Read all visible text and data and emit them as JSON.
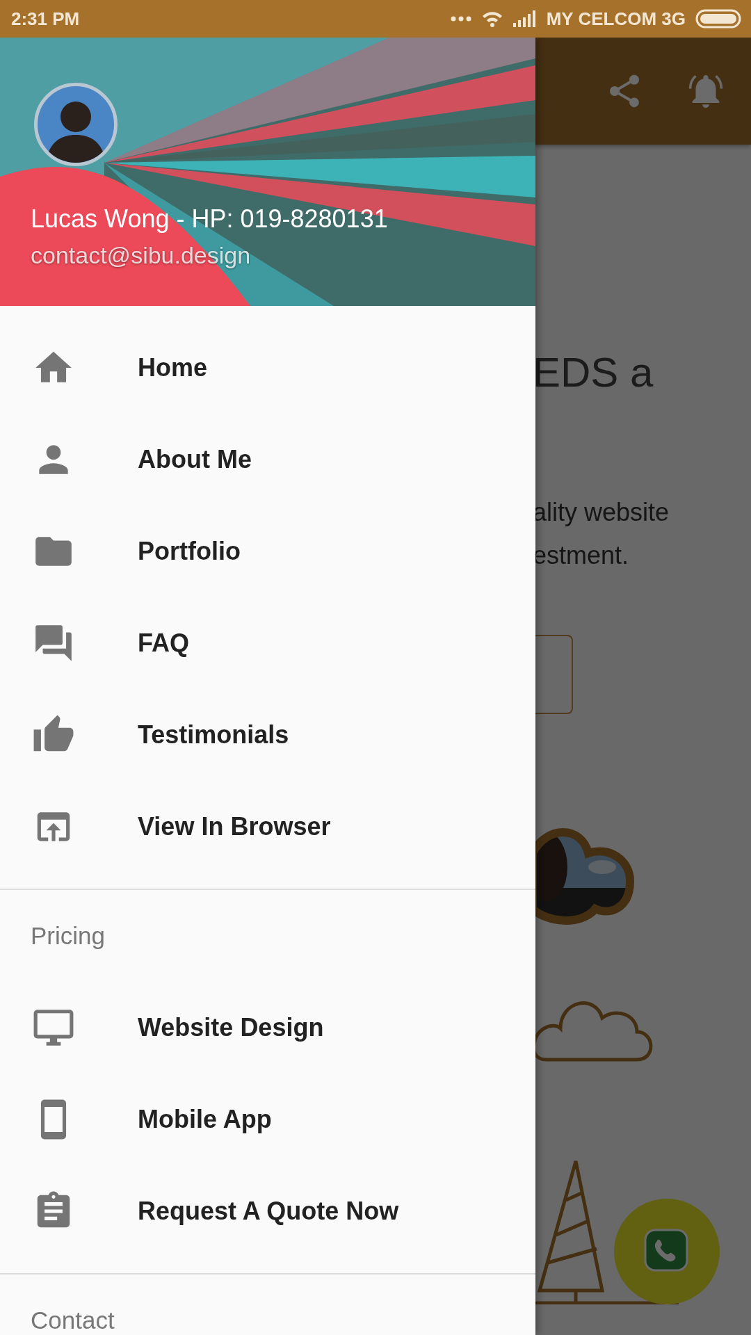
{
  "status_bar": {
    "time": "2:31 PM",
    "carrier": "MY CELCOM 3G"
  },
  "page_behind": {
    "headline": "EDS a",
    "body_lines": [
      "ality website",
      "estment."
    ]
  },
  "drawer": {
    "header": {
      "name": "Lucas Wong - HP: 019-8280131",
      "email": "contact@sibu.design"
    },
    "sections": [
      {
        "items": [
          {
            "label": "Home"
          },
          {
            "label": "About Me"
          },
          {
            "label": "Portfolio"
          },
          {
            "label": "FAQ"
          },
          {
            "label": "Testimonials"
          },
          {
            "label": "View In Browser"
          }
        ]
      },
      {
        "title": "Pricing",
        "items": [
          {
            "label": "Website Design"
          },
          {
            "label": "Mobile App"
          },
          {
            "label": "Request A Quote Now"
          }
        ]
      },
      {
        "title": "Contact"
      }
    ]
  }
}
